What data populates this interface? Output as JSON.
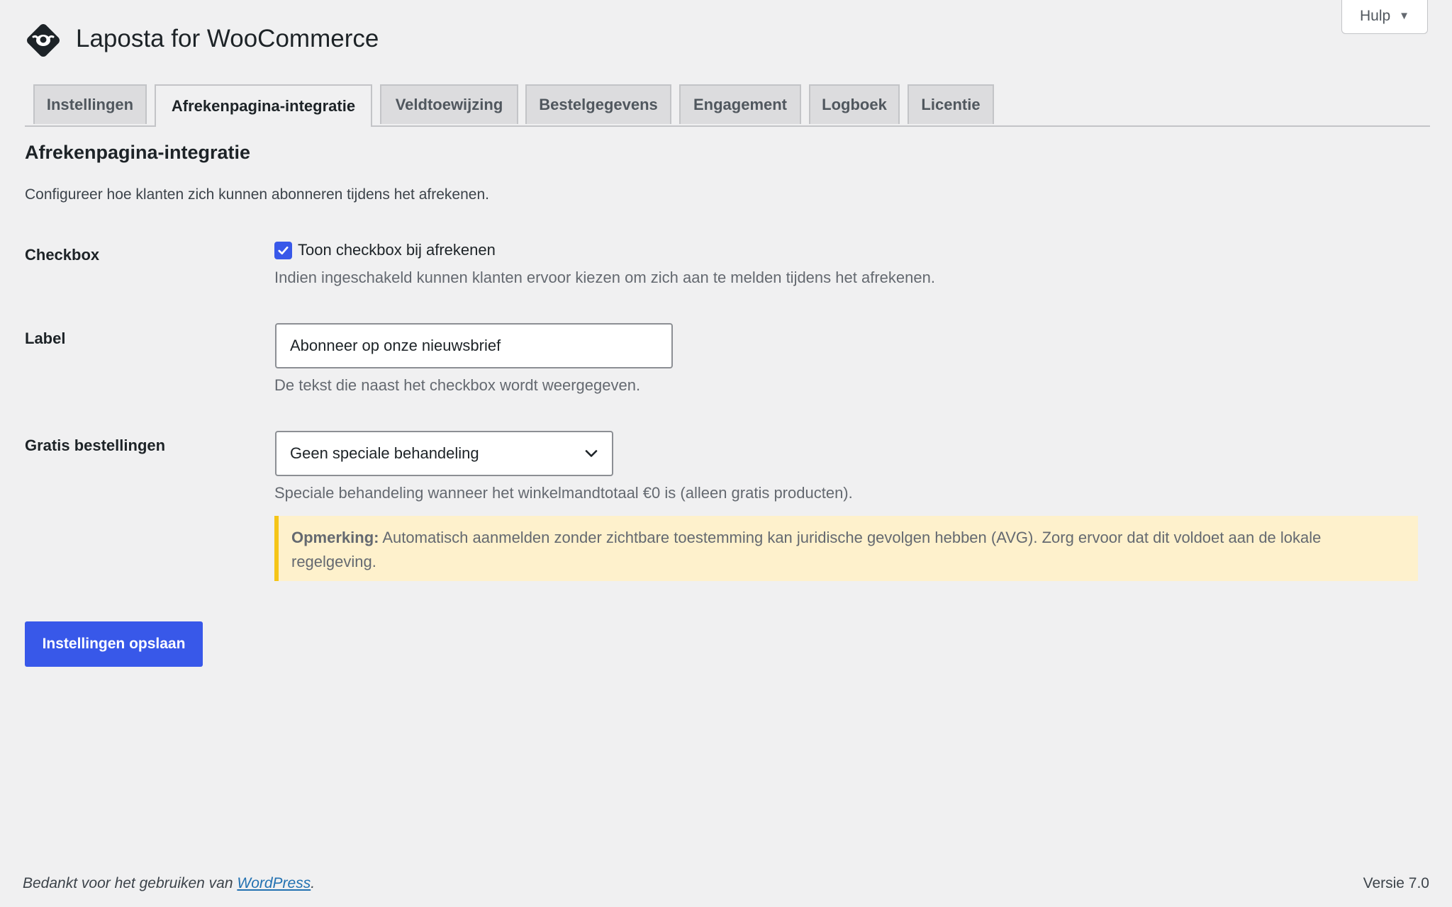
{
  "header": {
    "title": "Laposta for WooCommerce",
    "logo_icon": "laposta-logo-icon",
    "help_label": "Hulp",
    "help_caret": "▼"
  },
  "tabs": [
    {
      "label": "Instellingen",
      "active": false
    },
    {
      "label": "Afrekenpagina-integratie",
      "active": true
    },
    {
      "label": "Veldtoewijzing",
      "active": false
    },
    {
      "label": "Bestelgegevens",
      "active": false
    },
    {
      "label": "Engagement",
      "active": false
    },
    {
      "label": "Logboek",
      "active": false
    },
    {
      "label": "Licentie",
      "active": false
    }
  ],
  "section": {
    "title": "Afrekenpagina-integratie",
    "description": "Configureer hoe klanten zich kunnen abonneren tijdens het afrekenen."
  },
  "fields": {
    "checkbox": {
      "label": "Checkbox",
      "checked": true,
      "option_label": "Toon checkbox bij afrekenen",
      "description": "Indien ingeschakeld kunnen klanten ervoor kiezen om zich aan te melden tijdens het afrekenen."
    },
    "label": {
      "label": "Label",
      "value": "Abonneer op onze nieuwsbrief",
      "description": "De tekst die naast het checkbox wordt weergegeven."
    },
    "free_orders": {
      "label": "Gratis bestellingen",
      "selected": "Geen speciale behandeling",
      "description": "Speciale behandeling wanneer het winkelmandtotaal €0 is (alleen gratis producten).",
      "notice_strong": "Opmerking:",
      "notice_text": " Automatisch aanmelden zonder zichtbare toestemming kan juridische gevolgen hebben (AVG). Zorg ervoor dat dit voldoet aan de lokale regelgeving."
    }
  },
  "save_label": "Instellingen opslaan",
  "footer": {
    "thanks_prefix": "Bedankt voor het gebruiken van ",
    "wordpress_link": "WordPress",
    "thanks_suffix": ".",
    "version": "Versie 7.0"
  },
  "colors": {
    "accent": "#3858e9",
    "background": "#f0f0f1",
    "notice_bg": "#fef1cc",
    "notice_border": "#f5c518",
    "link": "#2271b1"
  }
}
